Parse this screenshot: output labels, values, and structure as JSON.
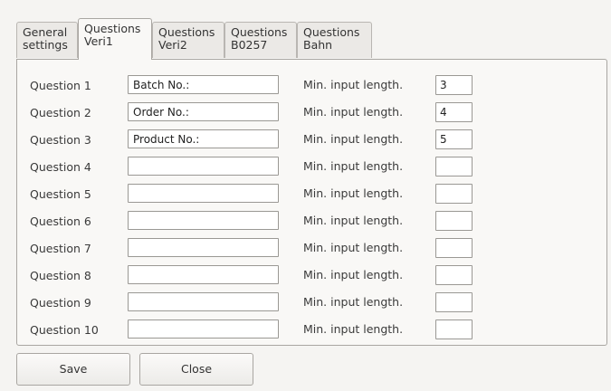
{
  "tabs": [
    {
      "line1": "General",
      "line2": "settings",
      "active": false
    },
    {
      "line1": "Questions",
      "line2": "Veri1",
      "active": true
    },
    {
      "line1": "Questions",
      "line2": "Veri2",
      "active": false
    },
    {
      "line1": "Questions",
      "line2": "B0257",
      "active": false
    },
    {
      "line1": "Questions",
      "line2": "Bahn",
      "active": false
    }
  ],
  "questions": [
    {
      "label": "Question 1",
      "value": "Batch No.:",
      "min_label": "Min. input length.",
      "min_value": "3"
    },
    {
      "label": "Question 2",
      "value": "Order No.:",
      "min_label": "Min. input length.",
      "min_value": "4"
    },
    {
      "label": "Question 3",
      "value": "Product No.:",
      "min_label": "Min. input length.",
      "min_value": "5"
    },
    {
      "label": "Question 4",
      "value": "",
      "min_label": "Min. input length.",
      "min_value": ""
    },
    {
      "label": "Question 5",
      "value": "",
      "min_label": "Min. input length.",
      "min_value": ""
    },
    {
      "label": "Question 6",
      "value": "",
      "min_label": "Min. input length.",
      "min_value": ""
    },
    {
      "label": "Question 7",
      "value": "",
      "min_label": "Min. input length.",
      "min_value": ""
    },
    {
      "label": "Question 8",
      "value": "",
      "min_label": "Min. input length.",
      "min_value": ""
    },
    {
      "label": "Question 9",
      "value": "",
      "min_label": "Min. input length.",
      "min_value": ""
    },
    {
      "label": "Question 10",
      "value": "",
      "min_label": "Min. input length.",
      "min_value": ""
    }
  ],
  "buttons": {
    "save_label": "Save",
    "close_label": "Close"
  }
}
